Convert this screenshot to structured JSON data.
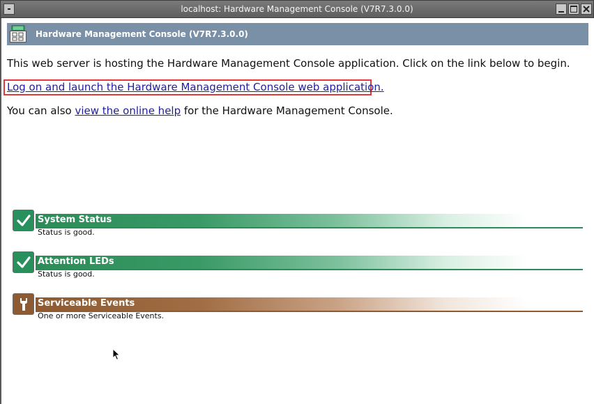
{
  "window": {
    "title": "localhost: Hardware Management Console (V7R7.3.0.0)"
  },
  "header": {
    "title": "Hardware Management Console (V7R7.3.0.0)",
    "icon": "console-app-icon"
  },
  "content": {
    "intro": "This web server is hosting the Hardware Management Console application.  Click on the link below to begin.",
    "launch_link": "Log on and launch the Hardware Management Console web application.",
    "help_prefix": "You can also ",
    "help_link": "view the online help",
    "help_suffix": " for the Hardware Management Console."
  },
  "status_items": [
    {
      "title": "System Status",
      "description": "Status is good.",
      "state": "good",
      "icon": "checkmark-icon",
      "color": "#2c8c58"
    },
    {
      "title": "Attention LEDs",
      "description": "Status is good.",
      "state": "good",
      "icon": "checkmark-icon",
      "color": "#2c8c58"
    },
    {
      "title": "Serviceable Events",
      "description": "One or more Serviceable Events.",
      "state": "attention",
      "icon": "wrench-icon",
      "color": "#8f5a30"
    }
  ],
  "colors": {
    "header_bg": "#7990a7",
    "link": "#1f1f9e",
    "highlight_box": "#e23a3a"
  }
}
